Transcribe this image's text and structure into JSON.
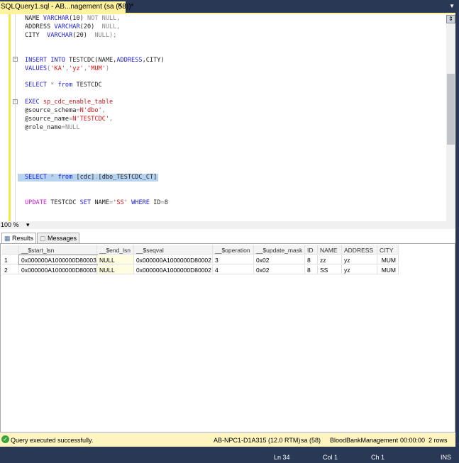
{
  "tab": {
    "title": "SQLQuery1.sql - AB...nagement (sa (58))*",
    "close": "✕"
  },
  "editor": {
    "lines": [
      [
        [
          "NAME ",
          "pl"
        ],
        [
          "VARCHAR",
          "kw"
        ],
        [
          "(10) ",
          "pl"
        ],
        [
          "NOT NULL",
          "gr"
        ],
        [
          ",",
          "gr"
        ]
      ],
      [
        [
          "ADDRESS ",
          "pl"
        ],
        [
          "VARCHAR",
          "kw"
        ],
        [
          "(20)  ",
          "pl"
        ],
        [
          "NULL",
          "gr"
        ],
        [
          ",",
          "gr"
        ]
      ],
      [
        [
          "CITY  ",
          "pl"
        ],
        [
          "VARCHAR",
          "kw"
        ],
        [
          "(20)  ",
          "pl"
        ],
        [
          "NULL",
          "gr"
        ],
        [
          ");",
          "gr"
        ]
      ],
      [
        [
          "INSERT INTO ",
          "kw"
        ],
        [
          "TESTCDC(NAME,",
          "pl"
        ],
        [
          "ADDRESS",
          "kw"
        ],
        [
          ",CITY)",
          "pl"
        ]
      ],
      [
        [
          "VALUES",
          "kw"
        ],
        [
          "(",
          "gr"
        ],
        [
          "'KA'",
          "str"
        ],
        [
          ",",
          "gr"
        ],
        [
          "'yz'",
          "str"
        ],
        [
          ",",
          "gr"
        ],
        [
          "'MUM'",
          "str"
        ],
        [
          ")",
          "gr"
        ]
      ],
      [
        [
          "SELECT ",
          "kw"
        ],
        [
          "* ",
          "gr"
        ],
        [
          "from ",
          "kw"
        ],
        [
          "TESTCDC",
          "pl"
        ]
      ],
      [
        [
          "EXEC ",
          "kw"
        ],
        [
          "sp_cdc_enable_table",
          "fn"
        ]
      ],
      [
        [
          "@source_schema",
          "pl"
        ],
        [
          "=",
          "gr"
        ],
        [
          "N'dbo'",
          "str"
        ],
        [
          ",",
          "gr"
        ]
      ],
      [
        [
          "@source_name",
          "pl"
        ],
        [
          "=",
          "gr"
        ],
        [
          "N'TESTCDC'",
          "str"
        ],
        [
          ",",
          "gr"
        ]
      ],
      [
        [
          "@role_name",
          "pl"
        ],
        [
          "=",
          "gr"
        ],
        [
          "NULL",
          "gr"
        ]
      ],
      [
        [
          "SELECT ",
          "kw"
        ],
        [
          "* ",
          "gr"
        ],
        [
          "from ",
          "kw"
        ],
        [
          "[cdc]",
          "pl"
        ],
        [
          ".",
          "gr"
        ],
        [
          "[dbo_TESTCDC_CT]",
          "pl"
        ]
      ],
      [
        [
          "UPDATE ",
          "pk"
        ],
        [
          "TESTCDC ",
          "pl"
        ],
        [
          "SET ",
          "kw"
        ],
        [
          "NAME",
          "pl"
        ],
        [
          "=",
          "gr"
        ],
        [
          "'SS' ",
          "str"
        ],
        [
          "WHERE ",
          "kw"
        ],
        [
          "ID",
          "pl"
        ],
        [
          "=",
          "gr"
        ],
        [
          "8",
          "pl"
        ]
      ]
    ]
  },
  "zoom": {
    "value": "100 %"
  },
  "results_tabs": {
    "results": "Results",
    "messages": "Messages"
  },
  "grid": {
    "columns": [
      "",
      "__$start_lsn",
      "__$end_lsn",
      "__$seqval",
      "__$operation",
      "__$update_mask",
      "ID",
      "NAME",
      "ADDRESS",
      "CITY"
    ],
    "rows": [
      [
        "1",
        "0x000000A1000000D80003",
        "NULL",
        "0x000000A1000000D80002",
        "3",
        "0x02",
        "8",
        "zz",
        "yz",
        "MUM"
      ],
      [
        "2",
        "0x000000A1000000D80003",
        "NULL",
        "0x000000A1000000D80002",
        "4",
        "0x02",
        "8",
        "SS",
        "yz",
        "MUM"
      ]
    ]
  },
  "status": {
    "message": "Query executed successfully.",
    "server": "AB-NPC1-D1A315 (12.0 RTM)",
    "user": "sa (58)",
    "database": "BloodBankManagement",
    "time": "00:00:00",
    "rows": "2 rows"
  },
  "bottom": {
    "ln": "Ln 34",
    "col": "Col 1",
    "ch": "Ch 1",
    "mode": "INS"
  },
  "colors": {
    "accent": "#293955",
    "tab": "#fff29d",
    "status": "#fdf4bf"
  }
}
